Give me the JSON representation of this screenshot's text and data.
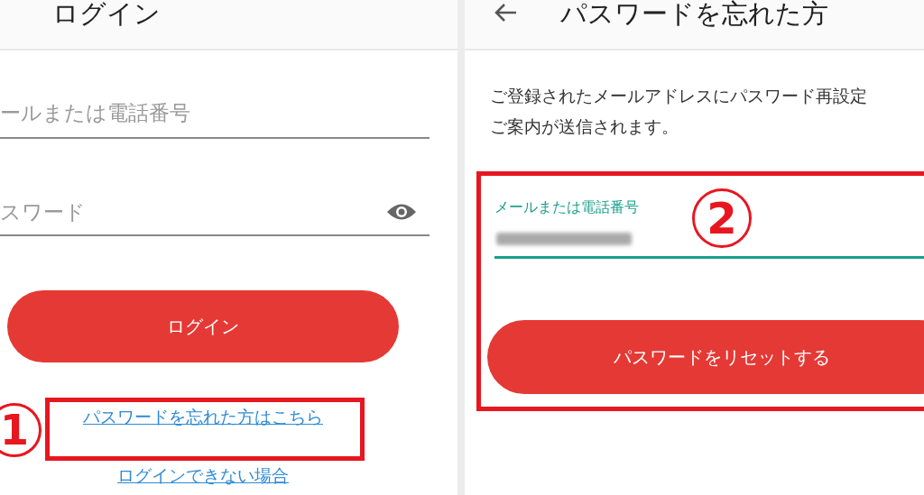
{
  "login_screen": {
    "title": "ログイン",
    "email_field": {
      "placeholder": "ールまたは電話番号"
    },
    "password_field": {
      "placeholder": "スワード"
    },
    "login_button": "ログイン",
    "forgot_link": "パスワードを忘れた方はこちら",
    "trouble_link": "ログインできない場合"
  },
  "reset_screen": {
    "title": "パスワードを忘れた方",
    "description": [
      "ご登録されたメールアドレスにパスワード再設定",
      "ご案内が送信されます。"
    ],
    "email_field": {
      "label": "メールまたは電話番号",
      "focused": true
    },
    "reset_button": "パスワードをリセットする"
  },
  "annotations": [
    {
      "number": "1"
    },
    {
      "number": "2"
    }
  ]
}
